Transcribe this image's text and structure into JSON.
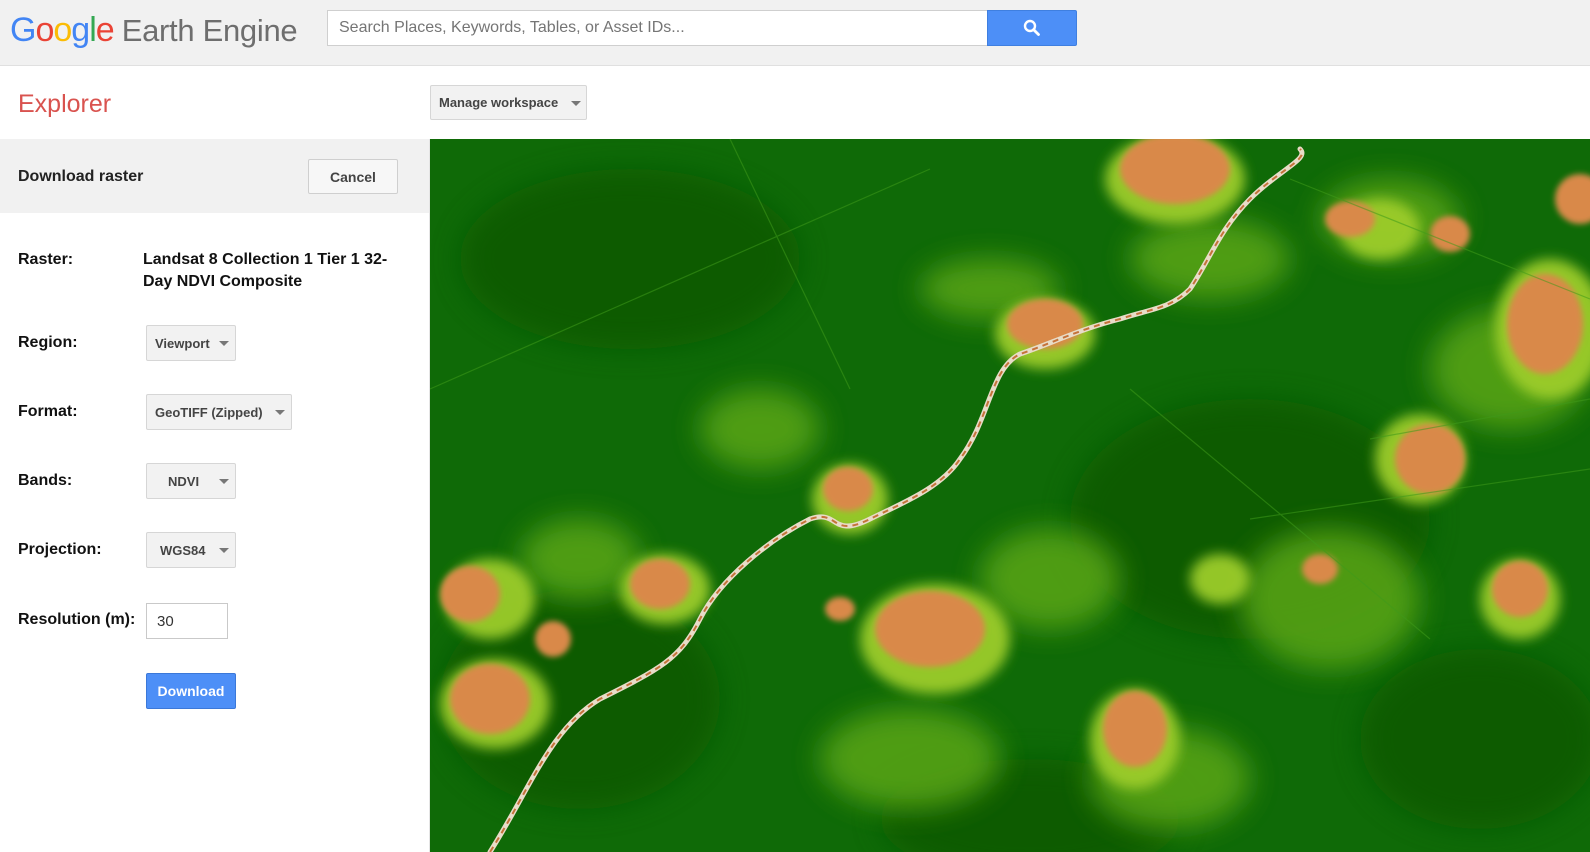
{
  "header": {
    "logo_letters": [
      "G",
      "o",
      "o",
      "g",
      "l",
      "e"
    ],
    "product_name": "Earth Engine",
    "search_placeholder": "Search Places, Keywords, Tables, or Asset IDs...",
    "search_icon": "search-icon"
  },
  "toolbar": {
    "explorer_title": "Explorer",
    "manage_workspace_label": "Manage workspace"
  },
  "download_panel": {
    "title": "Download raster",
    "cancel_label": "Cancel",
    "raster_label": "Raster:",
    "raster_value": "Landsat 8 Collection 1 Tier 1 32-Day NDVI Composite",
    "region_label": "Region:",
    "region_value": "Viewport",
    "format_label": "Format:",
    "format_value": "GeoTIFF (Zipped)",
    "bands_label": "Bands:",
    "bands_value": "NDVI",
    "projection_label": "Projection:",
    "projection_value": "WGS84",
    "resolution_label": "Resolution (m):",
    "resolution_value": "30",
    "download_label": "Download"
  },
  "colors": {
    "accent_blue": "#4d8ff7",
    "explorer_red": "#d9534f",
    "ndvi_high": "#0d6b06",
    "ndvi_mid": "#6fb51c",
    "ndvi_low": "#d98c4e"
  }
}
